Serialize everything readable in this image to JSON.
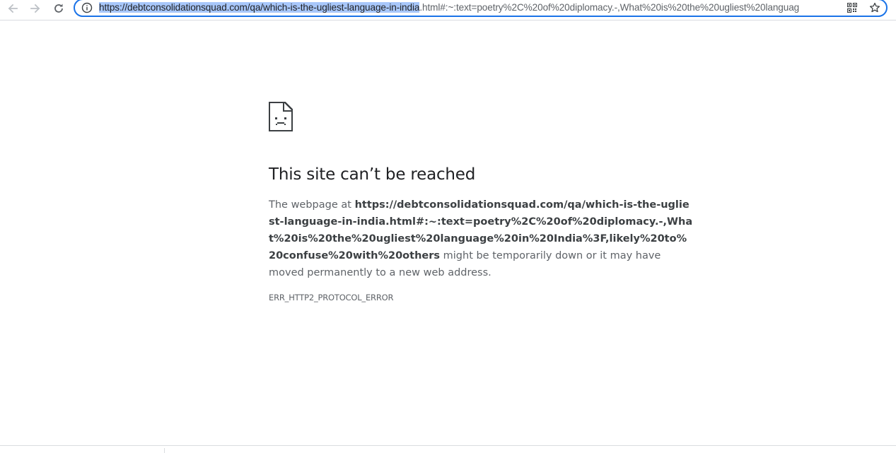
{
  "browser": {
    "nav": {
      "back_icon": "arrow-left-icon",
      "forward_icon": "arrow-right-icon",
      "reload_icon": "reload-icon"
    },
    "omnibox": {
      "info_icon": "info-icon",
      "url_selected": "https://debtconsolidationsquad.com/qa/which-is-the-ugliest-language-in-india",
      "url_rest": ".html#:~:text=poetry%2C%20of%20diplomacy.-,What%20is%20the%20ugliest%20languag",
      "qr_icon": "qr-code-icon",
      "bookmark_icon": "star-icon"
    }
  },
  "error": {
    "icon": "sad-page-icon",
    "title": "This site can’t be reached",
    "body_prefix": "The webpage at ",
    "url": "https://debtconsolidationsquad.com/qa/which-is-the-ugliest-language-in-india.html#:~:text=poetry%2C%20of%20diplomacy.-,What%20is%20the%20ugliest%20language%20in%20India%3F,likely%20to%20confuse%20with%20others",
    "body_suffix": " might be temporarily down or it may have moved permanently to a new web address.",
    "code": "ERR_HTTP2_PROTOCOL_ERROR"
  },
  "colors": {
    "accent": "#1a73e8",
    "selection": "#a8c7fa",
    "text_primary": "#202124",
    "text_secondary": "#5f6368"
  }
}
